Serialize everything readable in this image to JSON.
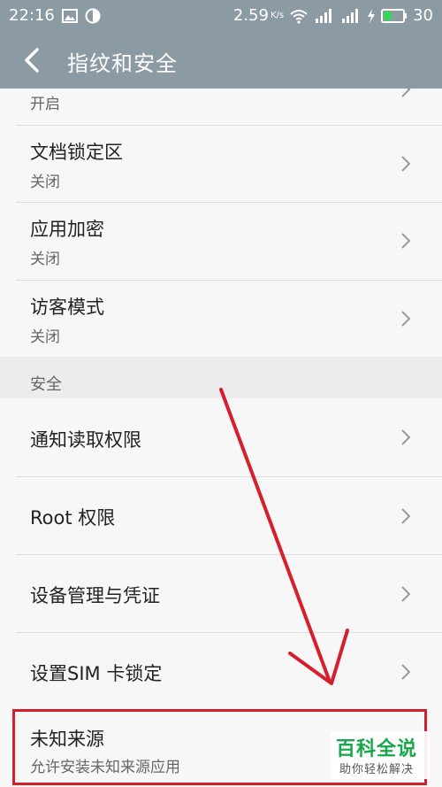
{
  "status_bar": {
    "time": "22:16",
    "speed": "2.59",
    "speed_unit": "K/s",
    "battery_level": "30"
  },
  "header": {
    "title": "指纹和安全"
  },
  "list": {
    "partial_item_sub": "开启",
    "items": [
      {
        "label": "文档锁定区",
        "sub": "关闭"
      },
      {
        "label": "应用加密",
        "sub": "关闭"
      },
      {
        "label": "访客模式",
        "sub": "关闭"
      }
    ],
    "section_title": "安全",
    "security_items": [
      {
        "label": "通知读取权限"
      },
      {
        "label": "Root 权限"
      },
      {
        "label": "设备管理与凭证"
      },
      {
        "label": "设置SIM 卡锁定"
      },
      {
        "label": "未知来源",
        "sub": "允许安装未知来源应用"
      }
    ]
  },
  "annotation": {
    "highlight_color": "#d61f2c"
  },
  "watermark": {
    "title": "百科全说",
    "subtitle": "助你轻松解决"
  }
}
